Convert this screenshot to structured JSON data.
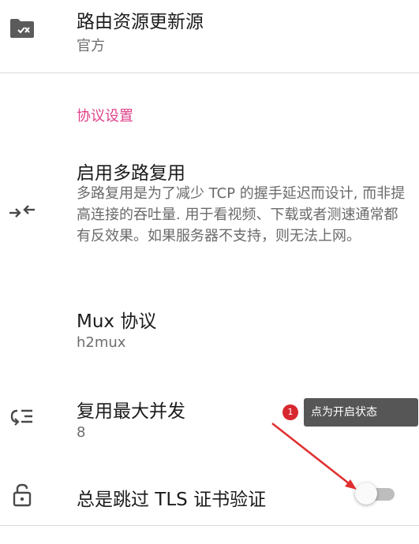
{
  "routing_source": {
    "title": "路由资源更新源",
    "value": "官方",
    "icon": "folder-x-icon"
  },
  "protocol_section": {
    "header": "协议设置"
  },
  "mux": {
    "title": "启用多路复用",
    "description": "多路复用是为了减少 TCP 的握手延迟而设计, 而非提高连接的吞吐量. 用于看视频、下载或者测速通常都有反效果。如果服务器不支持，则无法上网。",
    "icon": "arrows-in-icon"
  },
  "mux_protocol": {
    "title": "Mux 协议",
    "value": "h2mux"
  },
  "mux_concurrency": {
    "title": "复用最大并发",
    "value": "8",
    "icon": "list-loop-icon"
  },
  "tls_skip": {
    "title": "总是跳过 TLS 证书验证",
    "icon": "lock-icon",
    "enabled": false
  },
  "annotation": {
    "badge": "1",
    "text": "点为开启状态",
    "arrow_color": "#e02f2f",
    "badge_color": "#d8282f"
  },
  "accent_color": "#e0418a"
}
